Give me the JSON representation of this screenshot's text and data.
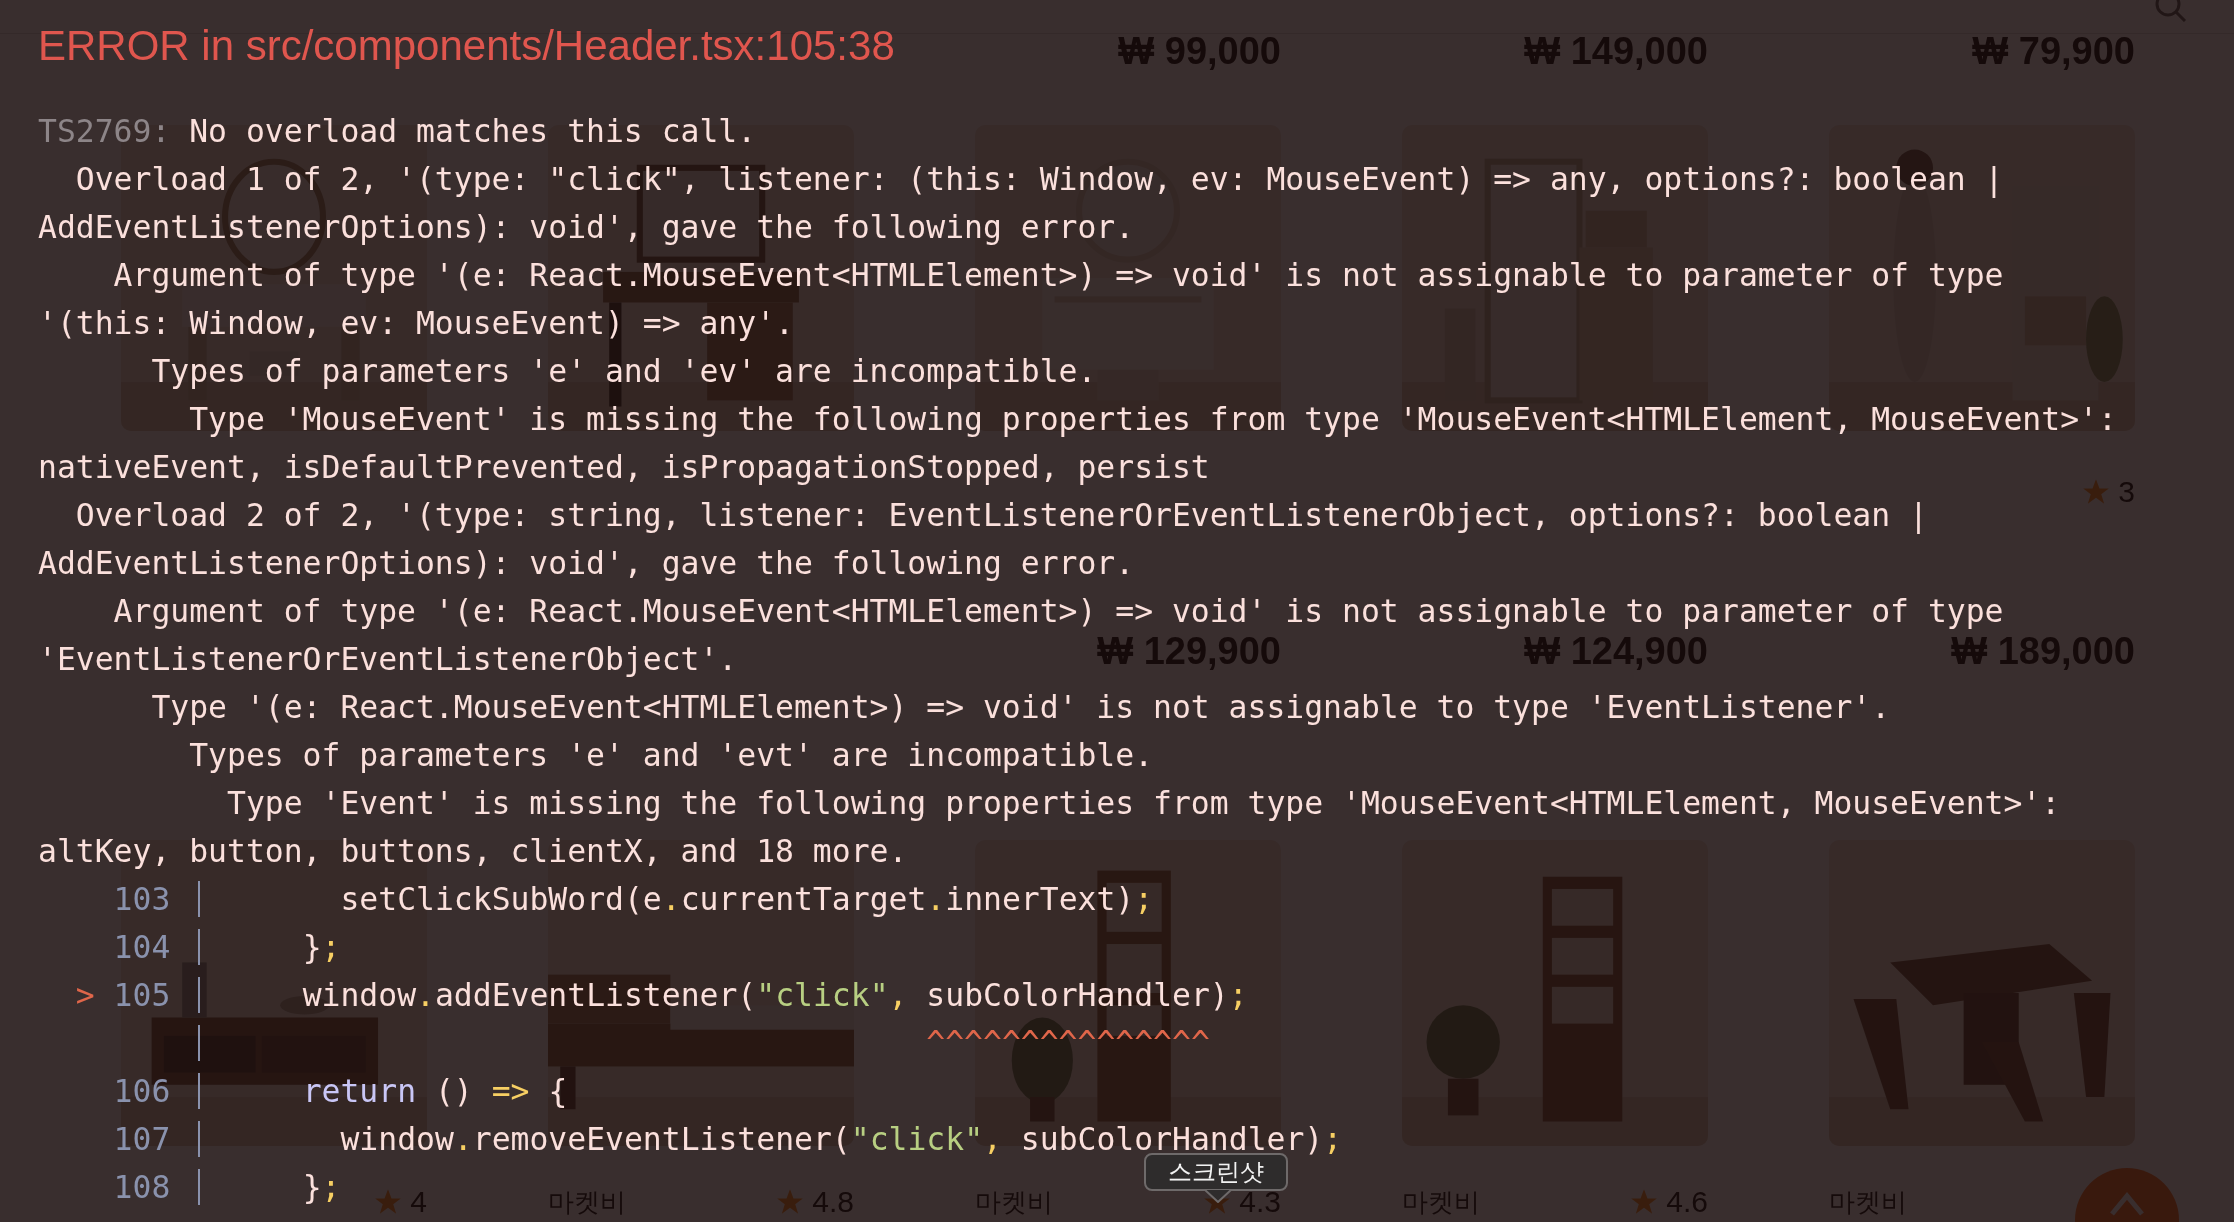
{
  "shop": {
    "top_prices": [
      "₩ 99,000",
      "₩ 149,000",
      "₩ 79,900"
    ],
    "sections": [
      {
        "cards": [
          {
            "kind": "product"
          },
          {
            "kind": "product"
          },
          {
            "kind": "product",
            "price": "₩ 129,900"
          },
          {
            "kind": "product",
            "price": "₩ 124,900"
          },
          {
            "kind": "product",
            "rating": "3",
            "price": "₩ 189,000"
          }
        ]
      },
      {
        "cards": [
          {
            "kind": "product",
            "rating": "4"
          },
          {
            "kind": "product",
            "brand": "마켓비",
            "rating": "4.8"
          },
          {
            "kind": "product",
            "brand": "마켓비",
            "rating": "4.3"
          },
          {
            "kind": "product",
            "brand": "마켓비",
            "rating": "4.6"
          },
          {
            "kind": "product",
            "brand": "마켓비"
          }
        ]
      }
    ]
  },
  "error_overlay": {
    "title": "ERROR in src/components/Header.tsx:105:38",
    "code": "TS2769:",
    "summary": " No overload matches this call.",
    "lines": [
      "  Overload 1 of 2, '(type: \"click\", listener: (this: Window, ev: MouseEvent) => any, options?: boolean |",
      "AddEventListenerOptions): void', gave the following error.",
      "    Argument of type '(e: React.MouseEvent<HTMLElement>) => void' is not assignable to parameter of type",
      "'(this: Window, ev: MouseEvent) => any'.",
      "      Types of parameters 'e' and 'ev' are incompatible.",
      "        Type 'MouseEvent' is missing the following properties from type 'MouseEvent<HTMLElement, MouseEvent>':",
      "nativeEvent, isDefaultPrevented, isPropagationStopped, persist",
      "  Overload 2 of 2, '(type: string, listener: EventListenerOrEventListenerObject, options?: boolean |",
      "AddEventListenerOptions): void', gave the following error.",
      "    Argument of type '(e: React.MouseEvent<HTMLElement>) => void' is not assignable to parameter of type",
      "'EventListenerOrEventListenerObject'.",
      "      Type '(e: React.MouseEvent<HTMLElement>) => void' is not assignable to type 'EventListener'.",
      "        Types of parameters 'e' and 'evt' are incompatible.",
      "          Type 'Event' is missing the following properties from type 'MouseEvent<HTMLElement, MouseEvent>':",
      "altKey, button, buttons, clientX, and 18 more."
    ],
    "code_frame": [
      {
        "line_number": "103",
        "tokens": [
          {
            "kind": "plain",
            "text": "      setClickSubWord(e"
          },
          {
            "kind": "punct",
            "text": "."
          },
          {
            "kind": "plain",
            "text": "currentTarget"
          },
          {
            "kind": "punct",
            "text": "."
          },
          {
            "kind": "plain",
            "text": "innerText)"
          },
          {
            "kind": "punct",
            "text": ";"
          }
        ]
      },
      {
        "line_number": "104",
        "tokens": [
          {
            "kind": "plain",
            "text": "    }"
          },
          {
            "kind": "punct",
            "text": ";"
          }
        ]
      },
      {
        "marker": ">",
        "line_number": "105",
        "tokens": [
          {
            "kind": "plain",
            "text": "    window"
          },
          {
            "kind": "punct",
            "text": "."
          },
          {
            "kind": "plain",
            "text": "addEventListener("
          },
          {
            "kind": "string",
            "text": "\"click\""
          },
          {
            "kind": "punct",
            "text": ","
          },
          {
            "kind": "plain",
            "text": " subColorHandler)"
          },
          {
            "kind": "punct",
            "text": ";"
          }
        ]
      },
      {
        "tokens": [
          {
            "kind": "caret",
            "text": "                                     ^^^^^^^^^^^^^^^"
          }
        ]
      },
      {
        "line_number": "106",
        "tokens": [
          {
            "kind": "keyword",
            "text": "    return"
          },
          {
            "kind": "plain",
            "text": " () "
          },
          {
            "kind": "punct",
            "text": "=>"
          },
          {
            "kind": "plain",
            "text": " {"
          }
        ]
      },
      {
        "line_number": "107",
        "tokens": [
          {
            "kind": "plain",
            "text": "      window"
          },
          {
            "kind": "punct",
            "text": "."
          },
          {
            "kind": "plain",
            "text": "removeEventListener("
          },
          {
            "kind": "string",
            "text": "\"click\""
          },
          {
            "kind": "punct",
            "text": ","
          },
          {
            "kind": "plain",
            "text": " subColorHandler)"
          },
          {
            "kind": "punct",
            "text": ";"
          }
        ]
      },
      {
        "line_number": "108",
        "tokens": [
          {
            "kind": "plain",
            "text": "    }"
          },
          {
            "kind": "punct",
            "text": ";"
          }
        ]
      }
    ]
  },
  "tooltip": {
    "text": "스크린샷"
  }
}
